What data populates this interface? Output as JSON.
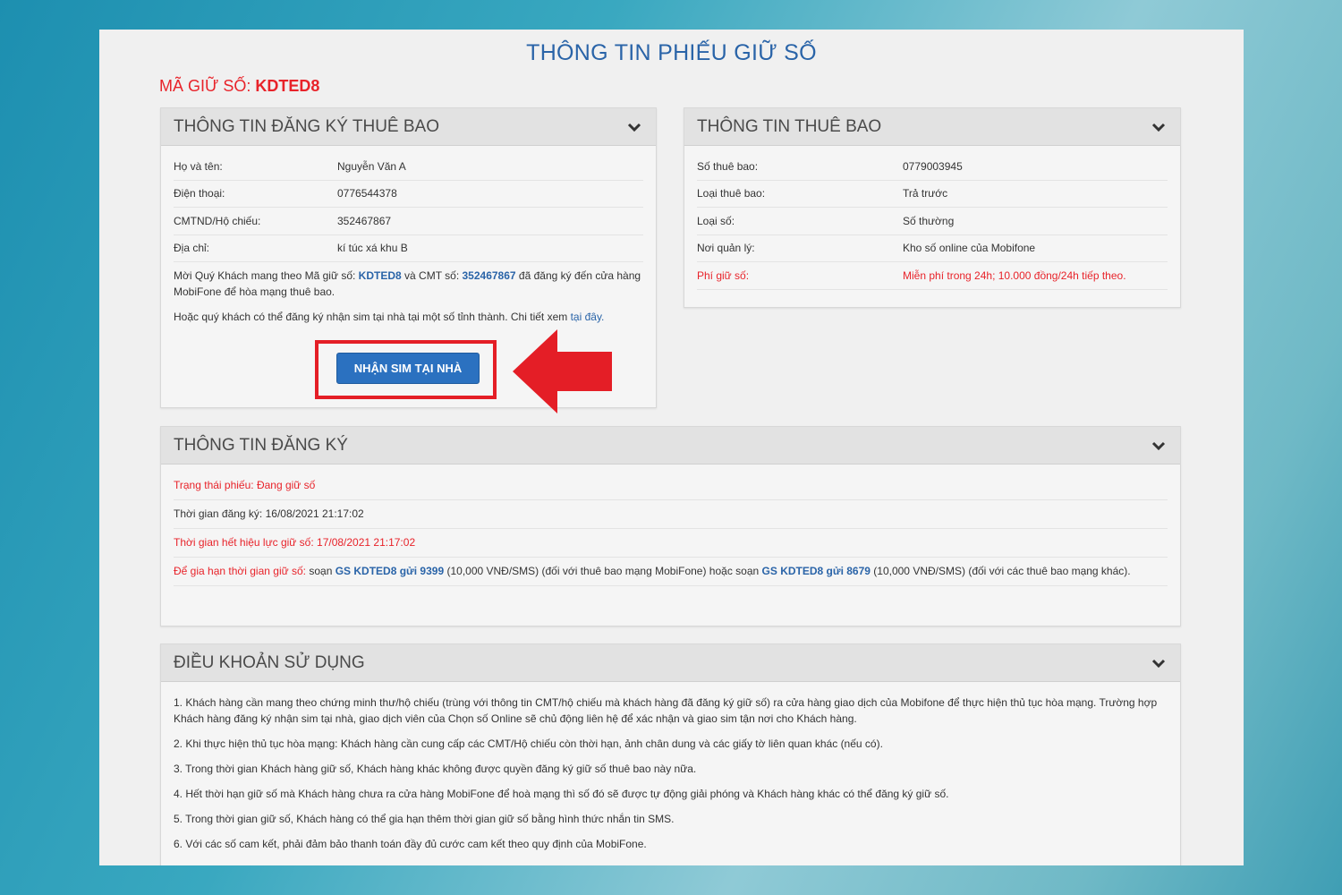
{
  "page_title": "THÔNG TIN PHIẾU GIỮ SỐ",
  "hold_code": {
    "label": "MÃ GIỮ SỐ:",
    "value": "KDTED8"
  },
  "registration_panel": {
    "title": "THÔNG TIN ĐĂNG KÝ THUÊ BAO",
    "rows": [
      {
        "label": "Họ và tên:",
        "value": "Nguyễn Văn A"
      },
      {
        "label": "Điện thoại:",
        "value": "0776544378"
      },
      {
        "label": "CMTND/Hộ chiếu:",
        "value": "352467867"
      },
      {
        "label": "Địa chỉ:",
        "value": "kí túc xá khu B"
      }
    ],
    "note1_a": "Mời Quý Khách mang theo Mã giữ số:",
    "note1_code": "KDTED8",
    "note1_b": "và CMT số:",
    "note1_id": "352467867",
    "note1_c": "đã đăng ký đến cửa hàng MobiFone để hòa mạng thuê bao.",
    "note2": "Hoặc quý khách có thể đăng ký nhận sim tại nhà tại một số tỉnh thành. Chi tiết xem",
    "note2_link": "tại đây.",
    "home_sim_button": "NHẬN SIM TẠI NHÀ"
  },
  "subscriber_panel": {
    "title": "THÔNG TIN THUÊ BAO",
    "rows": [
      {
        "label": "Số thuê bao:",
        "value": "0779003945"
      },
      {
        "label": "Loại thuê bao:",
        "value": "Trả trước"
      },
      {
        "label": "Loại số:",
        "value": "Số thường"
      },
      {
        "label": "Nơi quản lý:",
        "value": "Kho số online của Mobifone"
      },
      {
        "label": "Phí giữ số:",
        "value": "Miễn phí trong 24h; 10.000 đồng/24h tiếp theo."
      }
    ]
  },
  "signup_panel": {
    "title": "THÔNG TIN ĐĂNG KÝ",
    "status": "Trạng thái phiếu: Đang giữ số",
    "registered_time": "Thời gian đăng ký: 16/08/2021 21:17:02",
    "expiry_time": "Thời gian hết hiệu lực giữ số: 17/08/2021 21:17:02",
    "extend_label": "Để gia hạn thời gian giữ số:",
    "extend_a": "soạn",
    "extend_sms1": "GS KDTED8 gửi 9399",
    "extend_b": "(10,000 VNĐ/SMS) (đối với thuê bao mạng MobiFone) hoặc soạn",
    "extend_sms2": "GS KDTED8 gửi 8679",
    "extend_c": "(10,000 VNĐ/SMS) (đối với các thuê bao mạng khác)."
  },
  "terms_panel": {
    "title": "ĐIỀU KHOẢN SỬ DỤNG",
    "items": [
      "1. Khách hàng cần mang theo chứng minh thư/hộ chiếu (trùng với thông tin CMT/hộ chiếu mà khách hàng đã đăng ký giữ số) ra cửa hàng giao dịch của Mobifone để thực hiện thủ tục hòa mạng. Trường hợp Khách hàng đăng ký nhận sim tại nhà, giao dịch viên của Chọn số Online sẽ chủ động liên hệ để xác nhận và giao sim tận nơi cho Khách hàng.",
      "2. Khi thực hiện thủ tục hòa mạng: Khách hàng cần cung cấp các CMT/Hộ chiếu còn thời hạn, ảnh chân dung và các giấy tờ liên quan khác (nếu có).",
      "3. Trong thời gian Khách hàng giữ số, Khách hàng khác không được quyền đăng ký giữ số thuê bao này nữa.",
      "4. Hết thời hạn giữ số mà Khách hàng chưa ra cửa hàng MobiFone để hoà mạng thì số đó sẽ được tự động giải phóng và Khách hàng khác có thể đăng ký giữ số.",
      "5. Trong thời gian giữ số, Khách hàng có thể gia hạn thêm thời gian giữ số bằng hình thức nhắn tin SMS.",
      "6. Với các số cam kết, phải đảm bảo thanh toán đầy đủ cước cam kết theo quy định của MobiFone."
    ]
  },
  "colors": {
    "title_blue": "#2a64a8",
    "alert_red": "#e8232a",
    "button_blue": "#2b71c0"
  }
}
